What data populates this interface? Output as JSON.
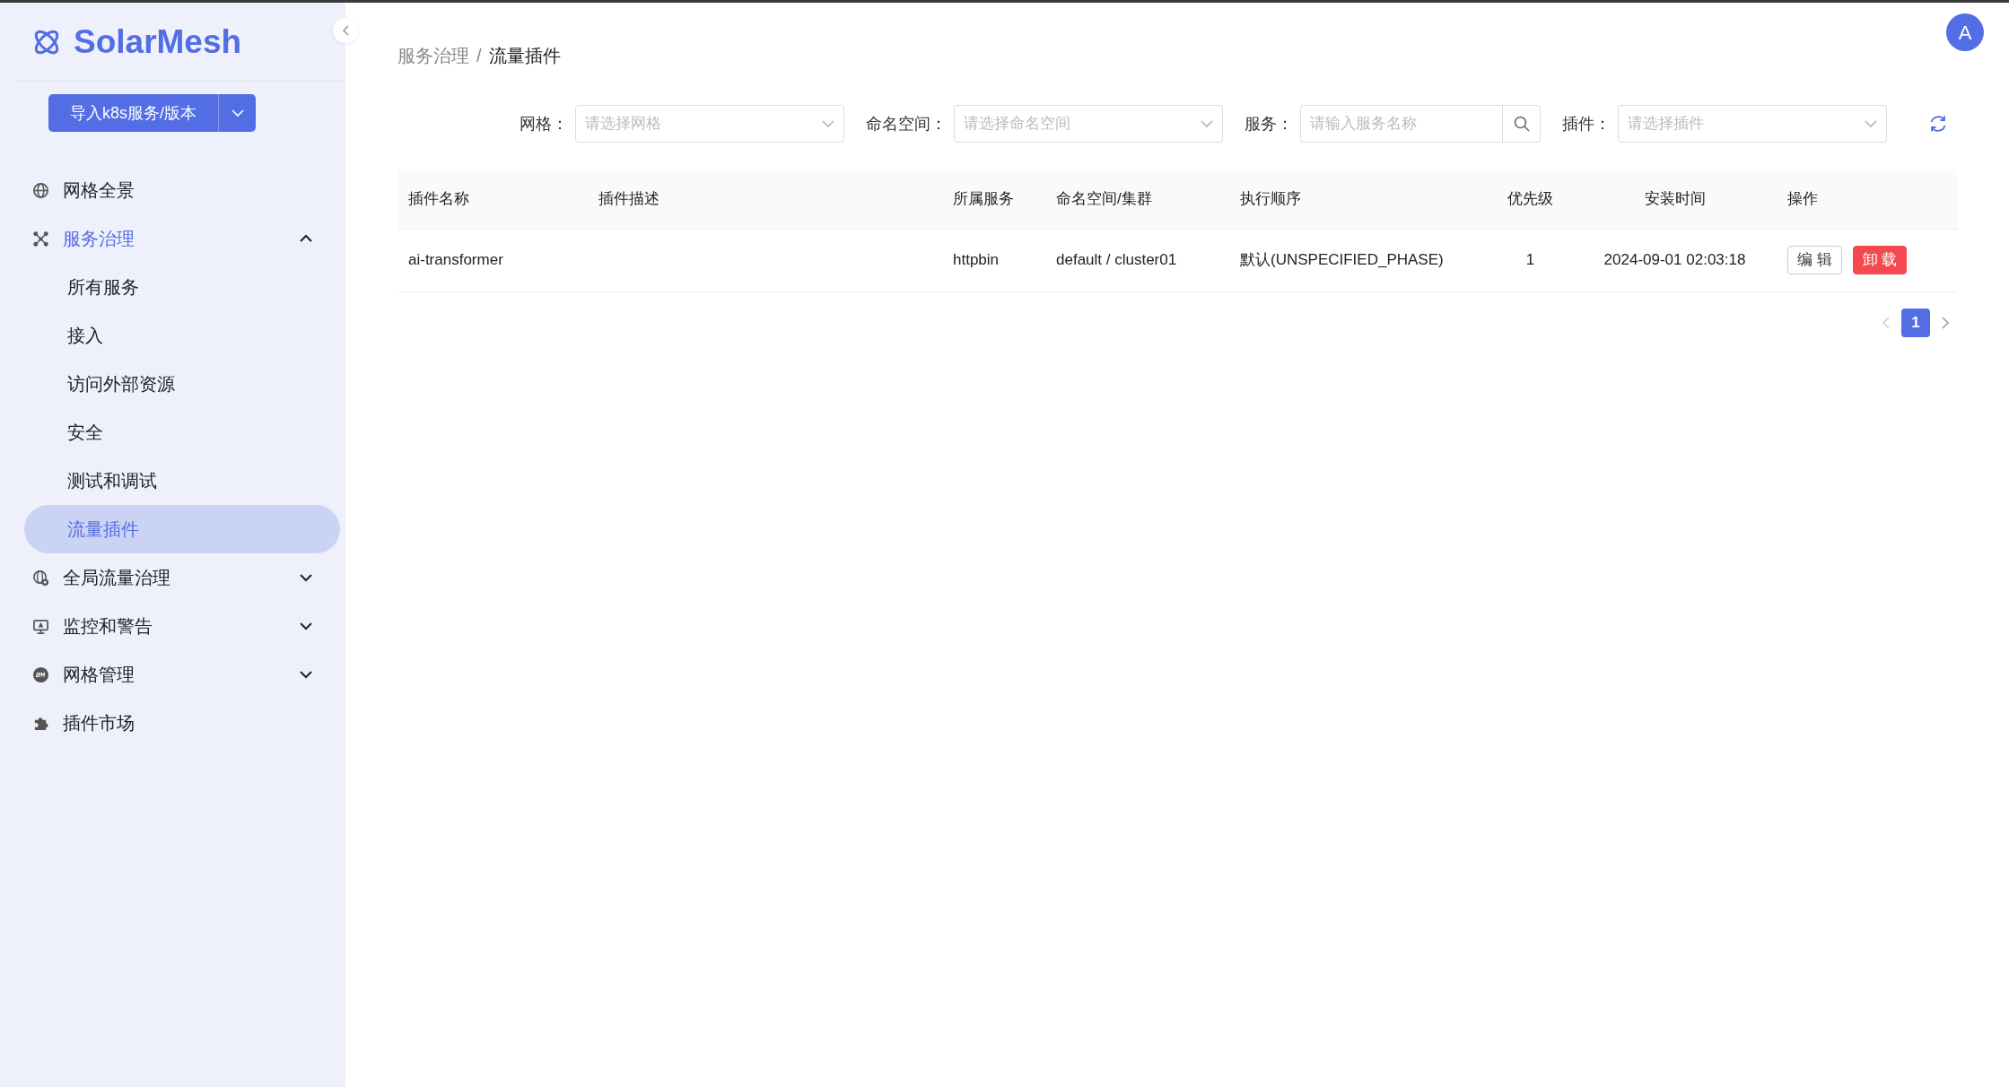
{
  "sidebar": {
    "logo": "SolarMesh",
    "import_button": {
      "label": "导入k8s服务/版本"
    },
    "menu": [
      {
        "label": "网格全景",
        "selected": false
      },
      {
        "label": "服务治理",
        "selected": true,
        "expanded": true,
        "children": [
          {
            "label": "所有服务",
            "selected": false
          },
          {
            "label": "接入",
            "selected": false
          },
          {
            "label": "访问外部资源",
            "selected": false
          },
          {
            "label": "安全",
            "selected": false
          },
          {
            "label": "测试和调试",
            "selected": false
          },
          {
            "label": "流量插件",
            "selected": true
          }
        ]
      },
      {
        "label": "全局流量治理",
        "selected": false,
        "expanded": false
      },
      {
        "label": "监控和警告",
        "selected": false,
        "expanded": false
      },
      {
        "label": "网格管理",
        "selected": false,
        "expanded": false
      },
      {
        "label": "插件市场",
        "selected": false
      }
    ]
  },
  "header": {
    "breadcrumb": [
      {
        "label": "服务治理",
        "current": false
      },
      {
        "label": "流量插件",
        "current": true
      }
    ],
    "separator": "/",
    "avatar": "A"
  },
  "filters": [
    {
      "label": "网格：",
      "kind": "select",
      "placeholder": "请选择网格"
    },
    {
      "label": "命名空间：",
      "kind": "select",
      "placeholder": "请选择命名空间"
    },
    {
      "label": "服务：",
      "kind": "search",
      "placeholder": "请输入服务名称"
    },
    {
      "label": "插件：",
      "kind": "select",
      "placeholder": "请选择插件"
    }
  ],
  "table": {
    "columns": [
      "插件名称",
      "插件描述",
      "所属服务",
      "命名空间/集群",
      "执行顺序",
      "优先级",
      "安装时间",
      "操作"
    ],
    "rows": [
      {
        "cells": [
          "ai-transformer",
          "",
          "httpbin",
          "default / cluster01",
          "默认(UNSPECIFIED_PHASE)",
          "1",
          "2024-09-01 02:03:18"
        ],
        "actions": [
          {
            "label": "编 辑",
            "kind": "default"
          },
          {
            "label": "卸 载",
            "kind": "danger"
          }
        ]
      }
    ]
  },
  "pagination": {
    "pages": [
      {
        "label": "1",
        "selected": true
      }
    ],
    "prev_disabled": true,
    "next_disabled": false
  }
}
